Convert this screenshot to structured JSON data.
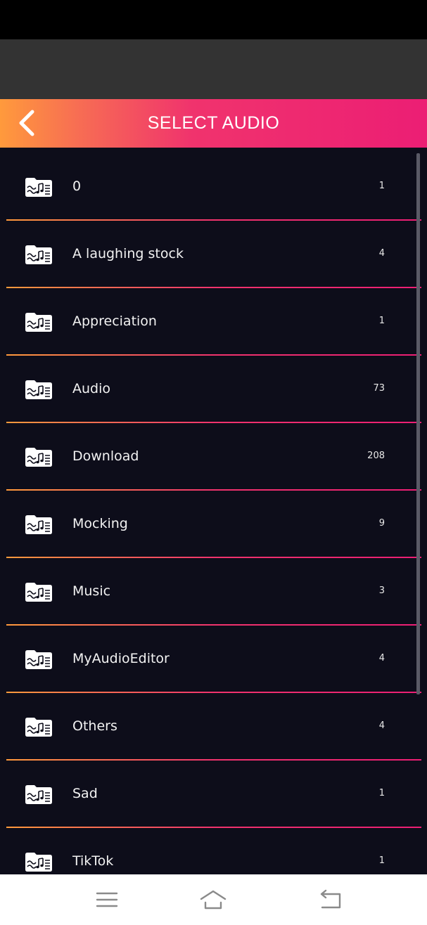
{
  "header": {
    "title": "SELECT AUDIO",
    "back_icon": "chevron-left-icon"
  },
  "folders": [
    {
      "name": "0",
      "count": "1"
    },
    {
      "name": "A laughing stock",
      "count": "4"
    },
    {
      "name": "Appreciation",
      "count": "1"
    },
    {
      "name": "Audio",
      "count": "73"
    },
    {
      "name": "Download",
      "count": "208"
    },
    {
      "name": "Mocking",
      "count": "9"
    },
    {
      "name": "Music",
      "count": "3"
    },
    {
      "name": "MyAudioEditor",
      "count": "4"
    },
    {
      "name": "Others",
      "count": "4"
    },
    {
      "name": "Sad",
      "count": "1"
    },
    {
      "name": "TikTok",
      "count": "1"
    }
  ],
  "folder_icon": "music-folder-icon",
  "nav": {
    "menu_icon": "menu-icon",
    "home_icon": "home-icon",
    "back_icon": "back-arrow-icon"
  },
  "colors": {
    "gradient_start": "#ff9a3c",
    "gradient_end": "#ec1e74",
    "list_background": "#0d0d1a",
    "status_bar": "#000000",
    "gray_band": "#333333"
  }
}
